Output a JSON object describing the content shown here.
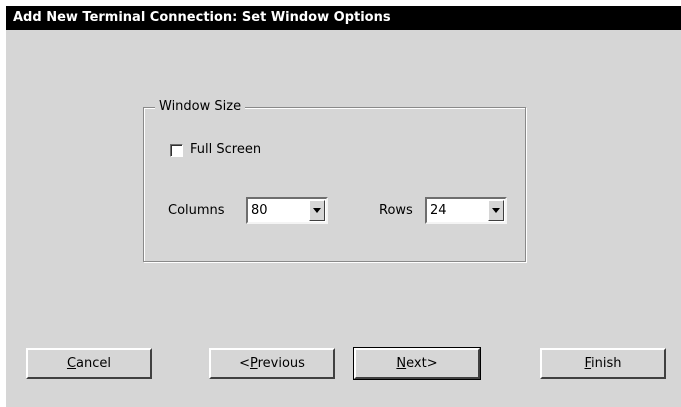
{
  "window": {
    "title": "Add New Terminal Connection: Set Window Options"
  },
  "window_size": {
    "legend": "Window Size",
    "full_screen_label": "Full Screen",
    "full_screen_checked": false,
    "columns_label": "Columns",
    "columns_value": "80",
    "rows_label": "Rows",
    "rows_value": "24"
  },
  "buttons": {
    "cancel": {
      "mnemonic": "C",
      "rest": "ancel"
    },
    "previous": {
      "prefix": "<",
      "mnemonic": "P",
      "rest": "revious"
    },
    "next": {
      "mnemonic": "N",
      "rest": "ext>"
    },
    "finish": {
      "mnemonic": "F",
      "rest": "inish"
    }
  }
}
